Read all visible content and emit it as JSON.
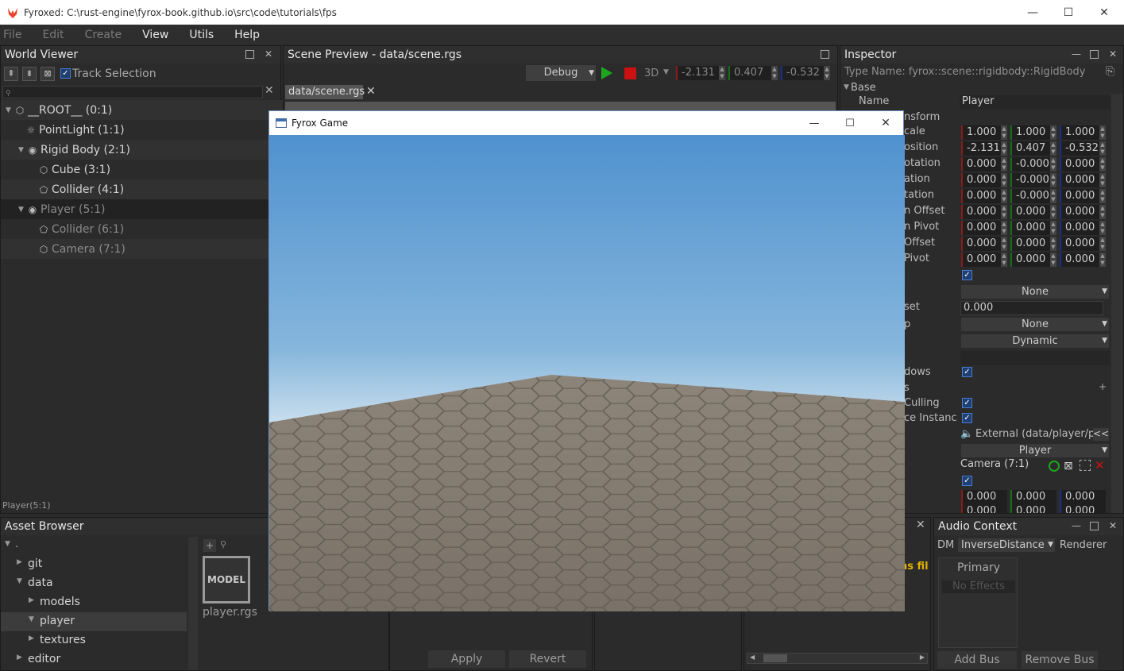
{
  "app": {
    "title": "Fyroxed: C:\\rust-engine\\fyrox-book.github.io\\src\\code\\tutorials\\fps",
    "min": "—",
    "max": "☐",
    "close": "✕"
  },
  "menu": [
    "File",
    "Edit",
    "Create",
    "View",
    "Utils",
    "Help"
  ],
  "world_viewer": {
    "title": "World Viewer",
    "track_selection": "Track Selection",
    "tree": [
      {
        "label": "__ROOT__ (0:1)",
        "icon": "cube-icon"
      },
      {
        "label": "PointLight (1:1)",
        "icon": "light-icon"
      },
      {
        "label": "Rigid Body (2:1)",
        "icon": "rigidbody-icon"
      },
      {
        "label": "Cube (3:1)",
        "icon": "cube-icon"
      },
      {
        "label": "Collider (4:1)",
        "icon": "collider-icon"
      },
      {
        "label": "Player (5:1)",
        "icon": "rigidbody-icon"
      },
      {
        "label": "Collider (6:1)",
        "icon": "collider-icon"
      },
      {
        "label": "Camera (7:1)",
        "icon": "cube-icon"
      }
    ],
    "status": "Player(5:1)"
  },
  "scene_preview": {
    "title": "Scene Preview - data/scene.rgs",
    "mode": "Debug",
    "view_mode": "3D",
    "coords": [
      "-2.131",
      "0.407",
      "-0.532"
    ],
    "tab": "data/scene.rgs"
  },
  "inspector": {
    "title": "Inspector",
    "type_name": "Type Name: fyrox::scene::rigidbody::RigidBody",
    "base": "Base",
    "name_label": "Name",
    "name_value": "Player",
    "labels": [
      "nsform",
      "cale",
      "osition",
      "otation",
      "ation",
      "tation",
      "n Offset",
      "n Pivot",
      "Offset",
      "Pivot"
    ],
    "rows": [
      [
        "1.000",
        "1.000",
        "1.000"
      ],
      [
        "-2.131",
        "0.407",
        "-0.532"
      ],
      [
        "0.000",
        "-0.000",
        "0.000"
      ],
      [
        "0.000",
        "-0.000",
        "0.000"
      ],
      [
        "0.000",
        "-0.000",
        "0.000"
      ],
      [
        "0.000",
        "0.000",
        "0.000"
      ],
      [
        "0.000",
        "0.000",
        "0.000"
      ],
      [
        "0.000",
        "0.000",
        "0.000"
      ],
      [
        "0.000",
        "0.000",
        "0.000"
      ]
    ],
    "none1": "None",
    "offset_label": "set",
    "offset_value": "0.000",
    "p_label": "p",
    "none2": "None",
    "dynamic": "Dynamic",
    "shadows_label": "dows",
    "s_label": "s",
    "culling_label": "Culling",
    "instance_label": "ce Instanc",
    "external": "External (data/player/pl",
    "external_btn": "<<",
    "player_dd": "Player",
    "camera_ref": "Camera (7:1)",
    "bottom_row": [
      "0.000",
      "0.000",
      "0.000"
    ],
    "partial_row": [
      "0.000",
      "0.000",
      "0.000"
    ]
  },
  "asset_browser": {
    "title": "Asset Browser",
    "tree": [
      "git",
      "data",
      "models",
      "player",
      "textures",
      "editor"
    ],
    "root": ".",
    "asset_thumb": "MODEL",
    "asset_name": "player.rgs",
    "apply": "Apply",
    "revert": "Revert"
  },
  "log": {
    "partial_text": "ns fil"
  },
  "audio_context": {
    "title": "Audio Context",
    "dm_label": "DM",
    "dm_value": "InverseDistance",
    "renderer_label": "Renderer",
    "primary": "Primary",
    "no_effects": "No Effects",
    "add_bus": "Add Bus",
    "remove_bus": "Remove Bus"
  },
  "game": {
    "title": "Fyrox Game",
    "min": "—",
    "max": "☐",
    "close": "✕"
  },
  "colors": {
    "accent": "#4a7bd0",
    "sky_top": "#4f91cf",
    "sky_horizon": "#cfe2ef",
    "floor": "#8a8276",
    "play_green": "#1ea51e",
    "stop_red": "#cc1111"
  }
}
